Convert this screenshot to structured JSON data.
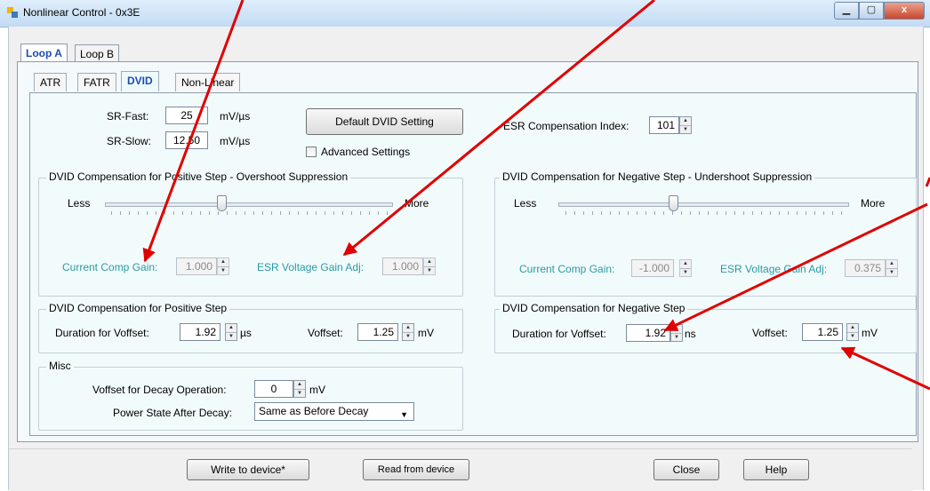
{
  "window": {
    "title": "Nonlinear Control - 0x3E",
    "min_icon": "minimize-icon",
    "max_icon": "maximize-icon",
    "close_glyph": "x"
  },
  "loop_tabs": [
    {
      "label": "Loop A",
      "active": true
    },
    {
      "label": "Loop B",
      "active": false
    }
  ],
  "sub_tabs": [
    {
      "label": "ATR"
    },
    {
      "label": "FATR"
    },
    {
      "label": "DVID",
      "active": true
    },
    {
      "label": "Non-Linear"
    }
  ],
  "sr": {
    "fast_label": "SR-Fast:",
    "fast_value": "25",
    "slow_label": "SR-Slow:",
    "slow_value": "12.50",
    "unit": "mV/µs"
  },
  "default_dvid_button": "Default DVID Setting",
  "advanced_settings_label": "Advanced Settings",
  "esr_index": {
    "label": "ESR Compensation Index:",
    "value": "101"
  },
  "positive_comp": {
    "title": "DVID Compensation for Positive Step - Overshoot Suppression",
    "less": "Less",
    "more": "More",
    "slider_position": 0.42,
    "current_label": "Current Comp Gain:",
    "current_value": "1.000",
    "esr_label": "ESR Voltage Gain Adj:",
    "esr_value": "1.000"
  },
  "negative_comp": {
    "title": "DVID Compensation for Negative Step - Undershoot Suppression",
    "less": "Less",
    "more": "More",
    "slider_position": 0.38,
    "current_label": "Current Comp Gain:",
    "current_value": "-1.000",
    "esr_label": "ESR Voltage Gain Adj:",
    "esr_value": "0.375"
  },
  "positive_step": {
    "title": "DVID Compensation for Positive Step",
    "duration_label": "Duration for Voffset:",
    "duration_value": "1.92",
    "duration_unit": "µs",
    "voffset_label": "Voffset:",
    "voffset_value": "1.25",
    "voffset_unit": "mV"
  },
  "negative_step": {
    "title": "DVID Compensation for Negative Step",
    "duration_label": "Duration for Voffset:",
    "duration_value": "1.92",
    "duration_unit": "ns",
    "voffset_label": "Voffset:",
    "voffset_value": "1.25",
    "voffset_unit": "mV"
  },
  "misc": {
    "title": "Misc",
    "decay_label": "Voffset for Decay Operation:",
    "decay_value": "0",
    "decay_unit": "mV",
    "power_label": "Power State After Decay:",
    "power_value": "Same as Before Decay"
  },
  "bottom_buttons": {
    "write": "Write to device*",
    "read": "Read from device",
    "close": "Close",
    "help": "Help"
  },
  "colors": {
    "annotation_arrow": "#e00000",
    "teal_label": "#2a9aa4",
    "active_tab": "#1b4eb2"
  }
}
